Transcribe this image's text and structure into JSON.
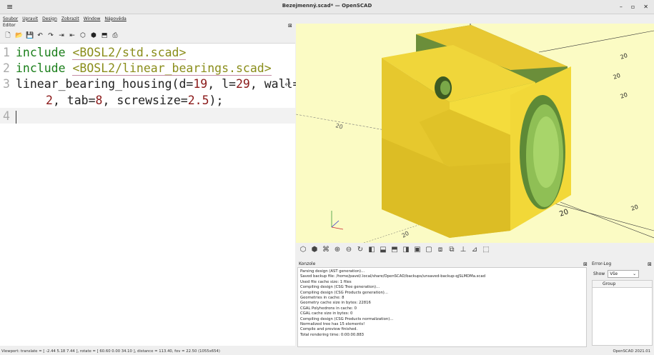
{
  "window": {
    "title": "Bezejmenný.scad* — OpenSCAD",
    "min": "–",
    "max": "▫",
    "close": "✕"
  },
  "menu": [
    "Soubor",
    "Upravit",
    "Design",
    "Zobrazit",
    "Window",
    "Nápověda"
  ],
  "editor": {
    "title": "Editor",
    "close": "⊠",
    "lines": {
      "l1_kw": "include",
      "l1_str": "<BOSL2/std.scad>",
      "l2_kw": "include",
      "l2_str": "<BOSL2/linear_bearings.scad>",
      "l3a": "linear_bearing_housing(d=",
      "l3_d": "19",
      "l3b": ", l=",
      "l3_l": "29",
      "l3c": ", wall=",
      "l3_wall": "2",
      "l3d": ", tab=",
      "l3_tab": "8",
      "l3e": ", screwsize=",
      "l3_screw": "2.5",
      "l3f": ");",
      "n1": "1",
      "n2": "2",
      "n3": "3",
      "n4": "4"
    }
  },
  "console": {
    "title": "Konzole",
    "close": "⊠",
    "lines": [
      "Parsing design (AST generation)...",
      "Saved backup file: /home/pavel/.local/share/OpenSCAD/backups/unsaved-backup-qjSLMDMa.scad",
      "Used file cache size: 1 files",
      "Compiling design (CSG Tree generation)...",
      "Compiling design (CSG Products generation)...",
      "Geometries in cache: 8",
      "Geometry cache size in bytes: 22816",
      "CGAL Polyhedrons in cache: 0",
      "CGAL cache size in bytes: 0",
      "Compiling design (CSG Products normalization)...",
      "Normalized tree has 15 elements!",
      "Compile and preview finished.",
      "Total rendering time: 0:00:00.883"
    ]
  },
  "errorlog": {
    "title": "Error-Log",
    "close": "⊠",
    "show_label": "Show",
    "show_value": "Vše",
    "column": "Group"
  },
  "axis_labels": [
    "20",
    "20",
    "20",
    "20",
    "20",
    "20",
    "20"
  ],
  "statusbar": {
    "viewport": "Viewport: translate = [ -2.44 5.18 7.44 ], rotate = [ 60.60 0.00 34.10 ], distance = 113.40, fov = 22.50 (1055x654)",
    "version": "OpenSCAD 2021.01"
  }
}
